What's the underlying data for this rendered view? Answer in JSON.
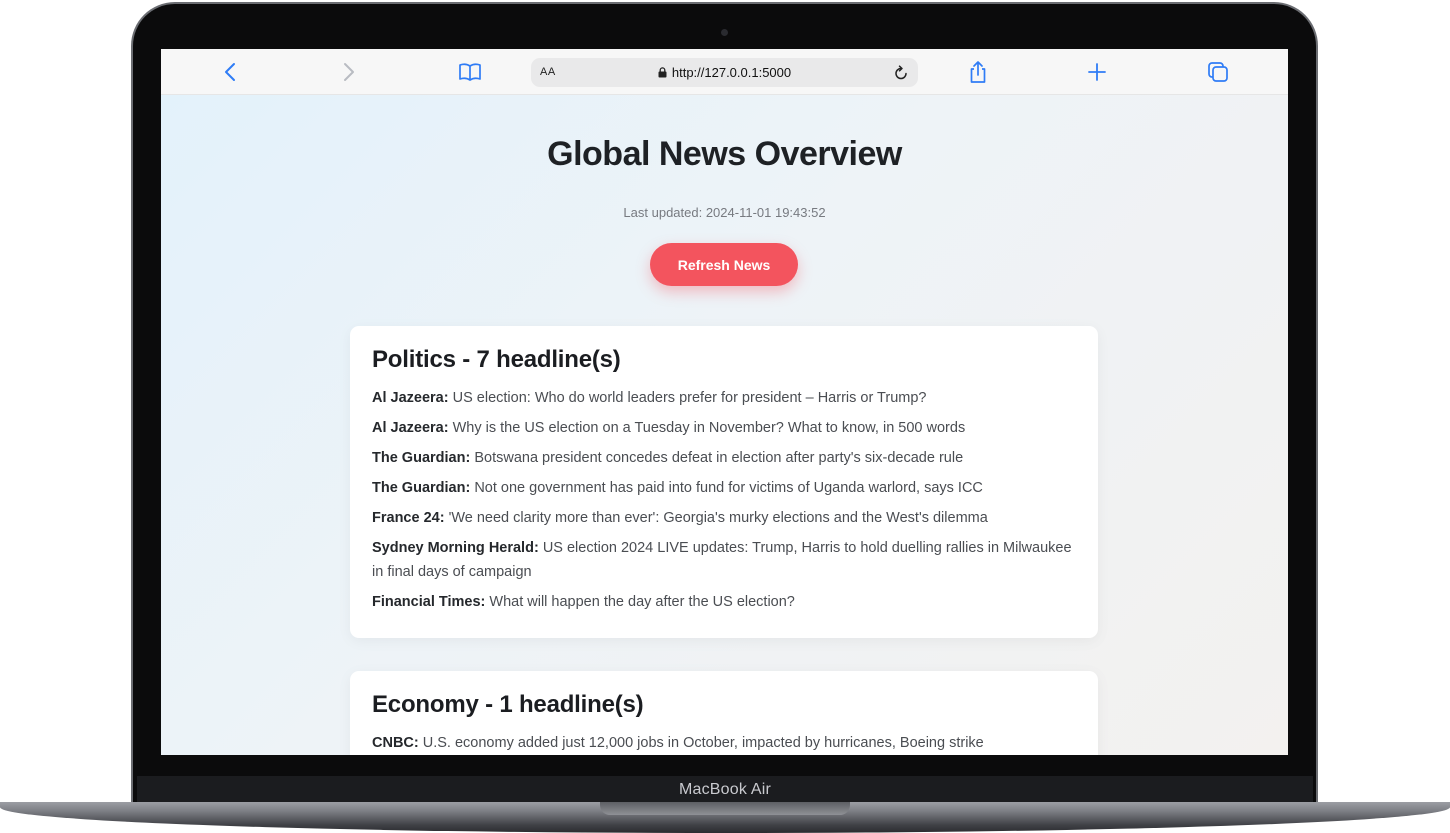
{
  "device": {
    "label": "MacBook Air"
  },
  "browser": {
    "text_size_label": "AA",
    "url": "http://127.0.0.1:5000"
  },
  "page": {
    "title": "Global News Overview",
    "last_updated": "Last updated: 2024-11-01 19:43:52",
    "refresh_label": "Refresh News",
    "accent_color": "#f3545e",
    "sections": [
      {
        "title": "Politics - 7 headline(s)",
        "headlines": [
          {
            "source": "Al Jazeera:",
            "text": "US election: Who do world leaders prefer for president – Harris or Trump?"
          },
          {
            "source": "Al Jazeera:",
            "text": "Why is the US election on a Tuesday in November? What to know, in 500 words"
          },
          {
            "source": "The Guardian:",
            "text": "Botswana president concedes defeat in election after party's six-decade rule"
          },
          {
            "source": "The Guardian:",
            "text": "Not one government has paid into fund for victims of Uganda warlord, says ICC"
          },
          {
            "source": "France 24:",
            "text": "'We need clarity more than ever': Georgia's murky elections and the West's dilemma"
          },
          {
            "source": "Sydney Morning Herald:",
            "text": "US election 2024 LIVE updates: Trump, Harris to hold duelling rallies in Milwaukee in final days of campaign"
          },
          {
            "source": "Financial Times:",
            "text": "What will happen the day after the US election?"
          }
        ]
      },
      {
        "title": "Economy - 1 headline(s)",
        "headlines": [
          {
            "source": "CNBC:",
            "text": "U.S. economy added just 12,000 jobs in October, impacted by hurricanes, Boeing strike"
          }
        ]
      }
    ]
  }
}
